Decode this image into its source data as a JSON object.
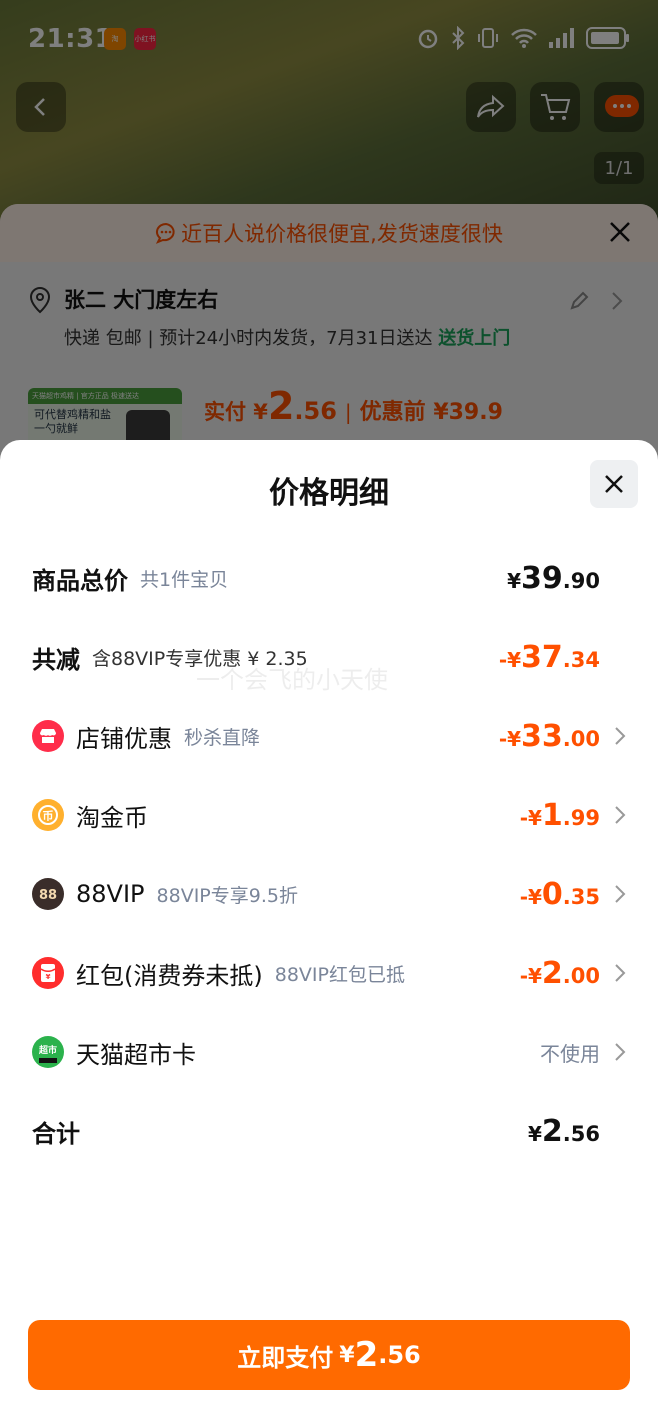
{
  "status_bar": {
    "time": "21:31",
    "app_badge_1": "淘",
    "app_badge_2": "小红书"
  },
  "product_page": {
    "page_counter": "1/1",
    "notice": "近百人说价格很便宜,发货速度很快",
    "address": "张二 大门度左右",
    "shipping_text": "快递 包邮 | 预计24小时内发货，7月31日送达",
    "shipping_highlight": "送货上门",
    "thumb_strip": "天猫超市鸡精 | 官方正品 极速送达",
    "thumb_text": "可代替鸡精和盐一勺就鲜",
    "price_label": "实付 ¥",
    "price_int": "2",
    "price_dec": ".56",
    "price_sep": "|",
    "price_before": "优惠前 ¥39.9"
  },
  "sheet": {
    "title": "价格明细",
    "rows": {
      "total": {
        "name": "商品总价",
        "sub": "共1件宝贝",
        "cur": "¥",
        "int": "39",
        "dec": ".90"
      },
      "reduce": {
        "name": "共减",
        "sub": "含88VIP专享优惠 ¥ 2.35",
        "cur": "-¥",
        "int": "37",
        "dec": ".34"
      },
      "shop": {
        "name": "店铺优惠",
        "sub": "秒杀直降",
        "cur": "-¥",
        "int": "33",
        "dec": ".00"
      },
      "coin": {
        "name": "淘金币",
        "cur": "-¥",
        "int": "1",
        "dec": ".99"
      },
      "vip": {
        "name": "88VIP",
        "sub": "88VIP专享9.5折",
        "cur": "-¥",
        "int": "0",
        "dec": ".35"
      },
      "redpack": {
        "name": "红包(消费券未抵)",
        "sub": "88VIP红包已抵",
        "cur": "-¥",
        "int": "2",
        "dec": ".00"
      },
      "card": {
        "name": "天猫超市卡",
        "value": "不使用"
      },
      "sum": {
        "name": "合计",
        "cur": "¥",
        "int": "2",
        "dec": ".56"
      }
    },
    "pay_button": {
      "label": "立即支付",
      "cur": "¥",
      "int": "2",
      "dec": ".56"
    },
    "watermark": "一个会飞的小天使"
  },
  "colors": {
    "accent": "#ff5000",
    "button": "#ff6a00",
    "green": "#1aa35b"
  }
}
